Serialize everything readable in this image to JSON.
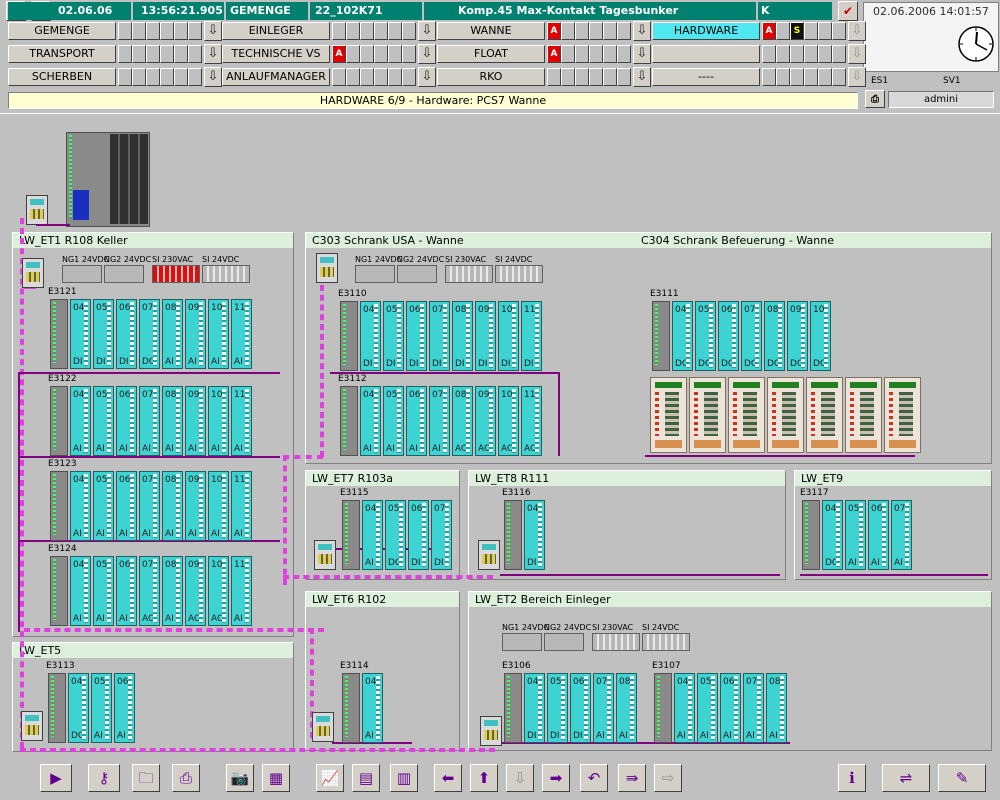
{
  "header": {
    "date": "02.06.06",
    "time": "13:56:21.905",
    "area": "GEMENGE",
    "tag": "22_102K71",
    "message": "Komp.45 Max-Kontakt Tagesbunker",
    "flag": "K"
  },
  "clock": {
    "datetime": "02.06.2006 14:01:57"
  },
  "station": {
    "es": "ES1",
    "sv": "SV1",
    "user": "admini"
  },
  "nav": [
    {
      "label": "GEMENGE",
      "alarm": ""
    },
    {
      "label": "TRANSPORT",
      "alarm": ""
    },
    {
      "label": "SCHERBEN",
      "alarm": ""
    },
    {
      "label": "EINLEGER",
      "alarm": ""
    },
    {
      "label": "TECHNISCHE VS",
      "alarm": "A"
    },
    {
      "label": "ANLAUFMANAGER",
      "alarm": ""
    },
    {
      "label": "WANNE",
      "alarm": "A"
    },
    {
      "label": "FLOAT",
      "alarm": "A"
    },
    {
      "label": "RKO",
      "alarm": ""
    },
    {
      "label": "HARDWARE",
      "alarm": "A",
      "extra": "S"
    },
    {
      "label": "",
      "alarm": ""
    },
    {
      "label": "----",
      "alarm": ""
    }
  ],
  "message_bar": "HARDWARE 6/9 - Hardware: PCS7 Wanne",
  "panels": {
    "et1": "LW_ET1  R108 Keller",
    "c303": "C303  Schrank USA - Wanne",
    "c304": "C304  Schrank Befeuerung - Wanne",
    "et7": "LW_ET7 R103a",
    "et8": "LW_ET8 R111",
    "et9": "LW_ET9",
    "et6": "LW_ET6 R102",
    "et2": "LW_ET2  Bereich Einleger",
    "et5": "LW_ET5"
  },
  "power_labels": {
    "ng1": "NG1 24VDC",
    "ng2": "NG2 24VDC",
    "si230": "SI 230VAC",
    "si24": "SI 24VDC"
  },
  "racks": [
    {
      "id": "E3121",
      "mods": [
        [
          "04",
          "DI"
        ],
        [
          "05",
          "DI"
        ],
        [
          "06",
          "DI"
        ],
        [
          "07",
          "DO"
        ],
        [
          "08",
          "AI"
        ],
        [
          "09",
          "AI"
        ],
        [
          "10",
          "AI"
        ],
        [
          "11",
          "AI"
        ]
      ]
    },
    {
      "id": "E3122",
      "mods": [
        [
          "04",
          "AI"
        ],
        [
          "05",
          "AI"
        ],
        [
          "06",
          "AI"
        ],
        [
          "07",
          "AI"
        ],
        [
          "08",
          "AI"
        ],
        [
          "09",
          "AI"
        ],
        [
          "10",
          "AI"
        ],
        [
          "11",
          "AI"
        ]
      ]
    },
    {
      "id": "E3123",
      "mods": [
        [
          "04",
          "AI"
        ],
        [
          "05",
          "AI"
        ],
        [
          "06",
          "AI"
        ],
        [
          "07",
          "AI"
        ],
        [
          "08",
          "AI"
        ],
        [
          "09",
          "AI"
        ],
        [
          "10",
          "AI"
        ],
        [
          "11",
          "AI"
        ]
      ]
    },
    {
      "id": "E3124",
      "mods": [
        [
          "04",
          "AI"
        ],
        [
          "05",
          "AI"
        ],
        [
          "06",
          "AI"
        ],
        [
          "07",
          "AO"
        ],
        [
          "08",
          "AI"
        ],
        [
          "09",
          "AO"
        ],
        [
          "10",
          "AO"
        ],
        [
          "11",
          "AI"
        ]
      ]
    },
    {
      "id": "E3110",
      "mods": [
        [
          "04",
          "DI"
        ],
        [
          "05",
          "DI"
        ],
        [
          "06",
          "DI"
        ],
        [
          "07",
          "DI"
        ],
        [
          "08",
          "DI"
        ],
        [
          "09",
          "DI"
        ],
        [
          "10",
          "DI"
        ],
        [
          "11",
          "DI"
        ]
      ]
    },
    {
      "id": "E3112",
      "mods": [
        [
          "04",
          "AI"
        ],
        [
          "05",
          "AI"
        ],
        [
          "06",
          "AI"
        ],
        [
          "07",
          "AI"
        ],
        [
          "08",
          "AO"
        ],
        [
          "09",
          "AO"
        ],
        [
          "10",
          "AO"
        ],
        [
          "11",
          "AO"
        ]
      ]
    },
    {
      "id": "E3111",
      "mods": [
        [
          "04",
          "DO"
        ],
        [
          "05",
          "DO"
        ],
        [
          "06",
          "DO"
        ],
        [
          "07",
          "DO"
        ],
        [
          "08",
          "DO"
        ],
        [
          "09",
          "DO"
        ],
        [
          "10",
          "DO"
        ]
      ]
    },
    {
      "id": "E3115",
      "mods": [
        [
          "04",
          "AI"
        ],
        [
          "05",
          "DO"
        ],
        [
          "06",
          "DI"
        ],
        [
          "07",
          "DI"
        ]
      ]
    },
    {
      "id": "E3116",
      "mods": [
        [
          "04",
          "DI"
        ]
      ]
    },
    {
      "id": "E3117",
      "mods": [
        [
          "04",
          "DO"
        ],
        [
          "05",
          "AI"
        ],
        [
          "06",
          "AI"
        ],
        [
          "07",
          "AI"
        ]
      ]
    },
    {
      "id": "E3113",
      "mods": [
        [
          "04",
          "DO"
        ],
        [
          "05",
          "AI"
        ],
        [
          "06",
          "AI"
        ]
      ]
    },
    {
      "id": "E3114",
      "mods": [
        [
          "04",
          "AI"
        ]
      ]
    },
    {
      "id": "E3106",
      "mods": [
        [
          "04",
          "DI"
        ],
        [
          "05",
          "DI"
        ],
        [
          "06",
          "DI"
        ],
        [
          "07",
          "AI"
        ],
        [
          "08",
          "AI"
        ]
      ]
    },
    {
      "id": "E3107",
      "mods": [
        [
          "04",
          "AI"
        ],
        [
          "05",
          "AI"
        ],
        [
          "06",
          "AI"
        ],
        [
          "07",
          "AI"
        ],
        [
          "08",
          "AI"
        ]
      ]
    }
  ],
  "toolbar_icons": [
    "play-icon",
    "key-icon",
    "folder-icon",
    "printer-icon",
    "camera-icon",
    "calculator-icon",
    "trend-icon",
    "report-icon",
    "table-icon",
    "left-arrow-icon",
    "up-arrow-icon",
    "down-arrow-icon",
    "right-arrow-icon",
    "back-icon",
    "goto-icon",
    "forward-icon",
    "info-icon",
    "network-icon",
    "alarm-icon"
  ]
}
